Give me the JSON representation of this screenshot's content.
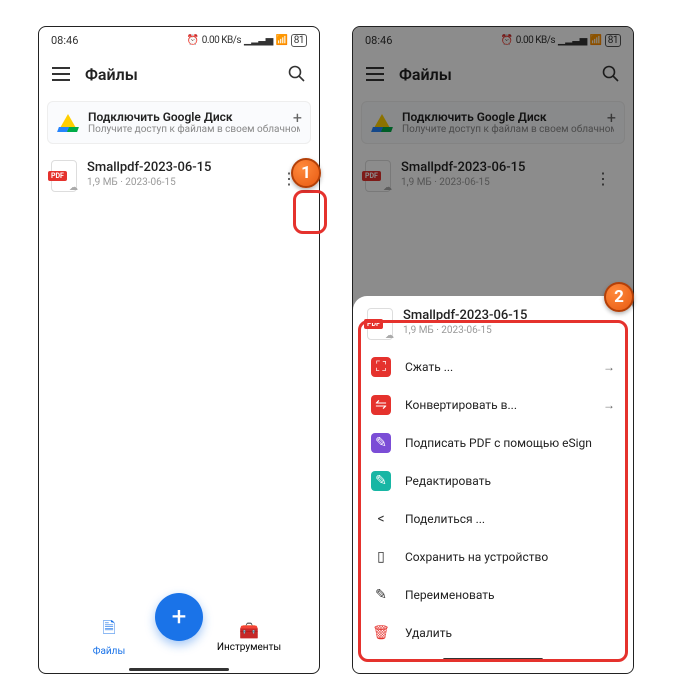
{
  "status": {
    "time": "08:46",
    "net": "0.00\nKB/s",
    "cell": "▁▂▃▅",
    "batt": "81"
  },
  "appbar": {
    "title": "Файлы"
  },
  "banner": {
    "title": "Подключить Google Диск",
    "subtitle": "Получите доступ к файлам в своем облачном хранилище"
  },
  "file": {
    "name": "Smallpdf-2023-06-15",
    "meta": "1,9 МБ · 2023-06-15"
  },
  "bottom": {
    "files": "Файлы",
    "tools": "Инструменты"
  },
  "sheet": {
    "items": [
      {
        "icon": "⛶",
        "cls": "mi-red",
        "label": "Сжать ...",
        "arrow": true
      },
      {
        "icon": "⇋",
        "cls": "mi-red",
        "label": "Конвертировать в...",
        "arrow": true
      },
      {
        "icon": "✎",
        "cls": "mi-purple",
        "label": "Подписать PDF с помощью eSign",
        "arrow": false
      },
      {
        "icon": "✎",
        "cls": "mi-teal",
        "label": "Редактировать",
        "arrow": false
      },
      {
        "icon": "<",
        "cls": "mi-plain",
        "label": "Поделиться ...",
        "arrow": false
      },
      {
        "icon": "▯",
        "cls": "mi-plain",
        "label": "Сохранить на устройство",
        "arrow": false
      },
      {
        "icon": "✎",
        "cls": "mi-plain",
        "label": "Переименовать",
        "arrow": false
      },
      {
        "icon": "🗑",
        "cls": "mi-del",
        "label": "Удалить",
        "arrow": false
      }
    ]
  },
  "markers": {
    "m1": "1",
    "m2": "2"
  }
}
